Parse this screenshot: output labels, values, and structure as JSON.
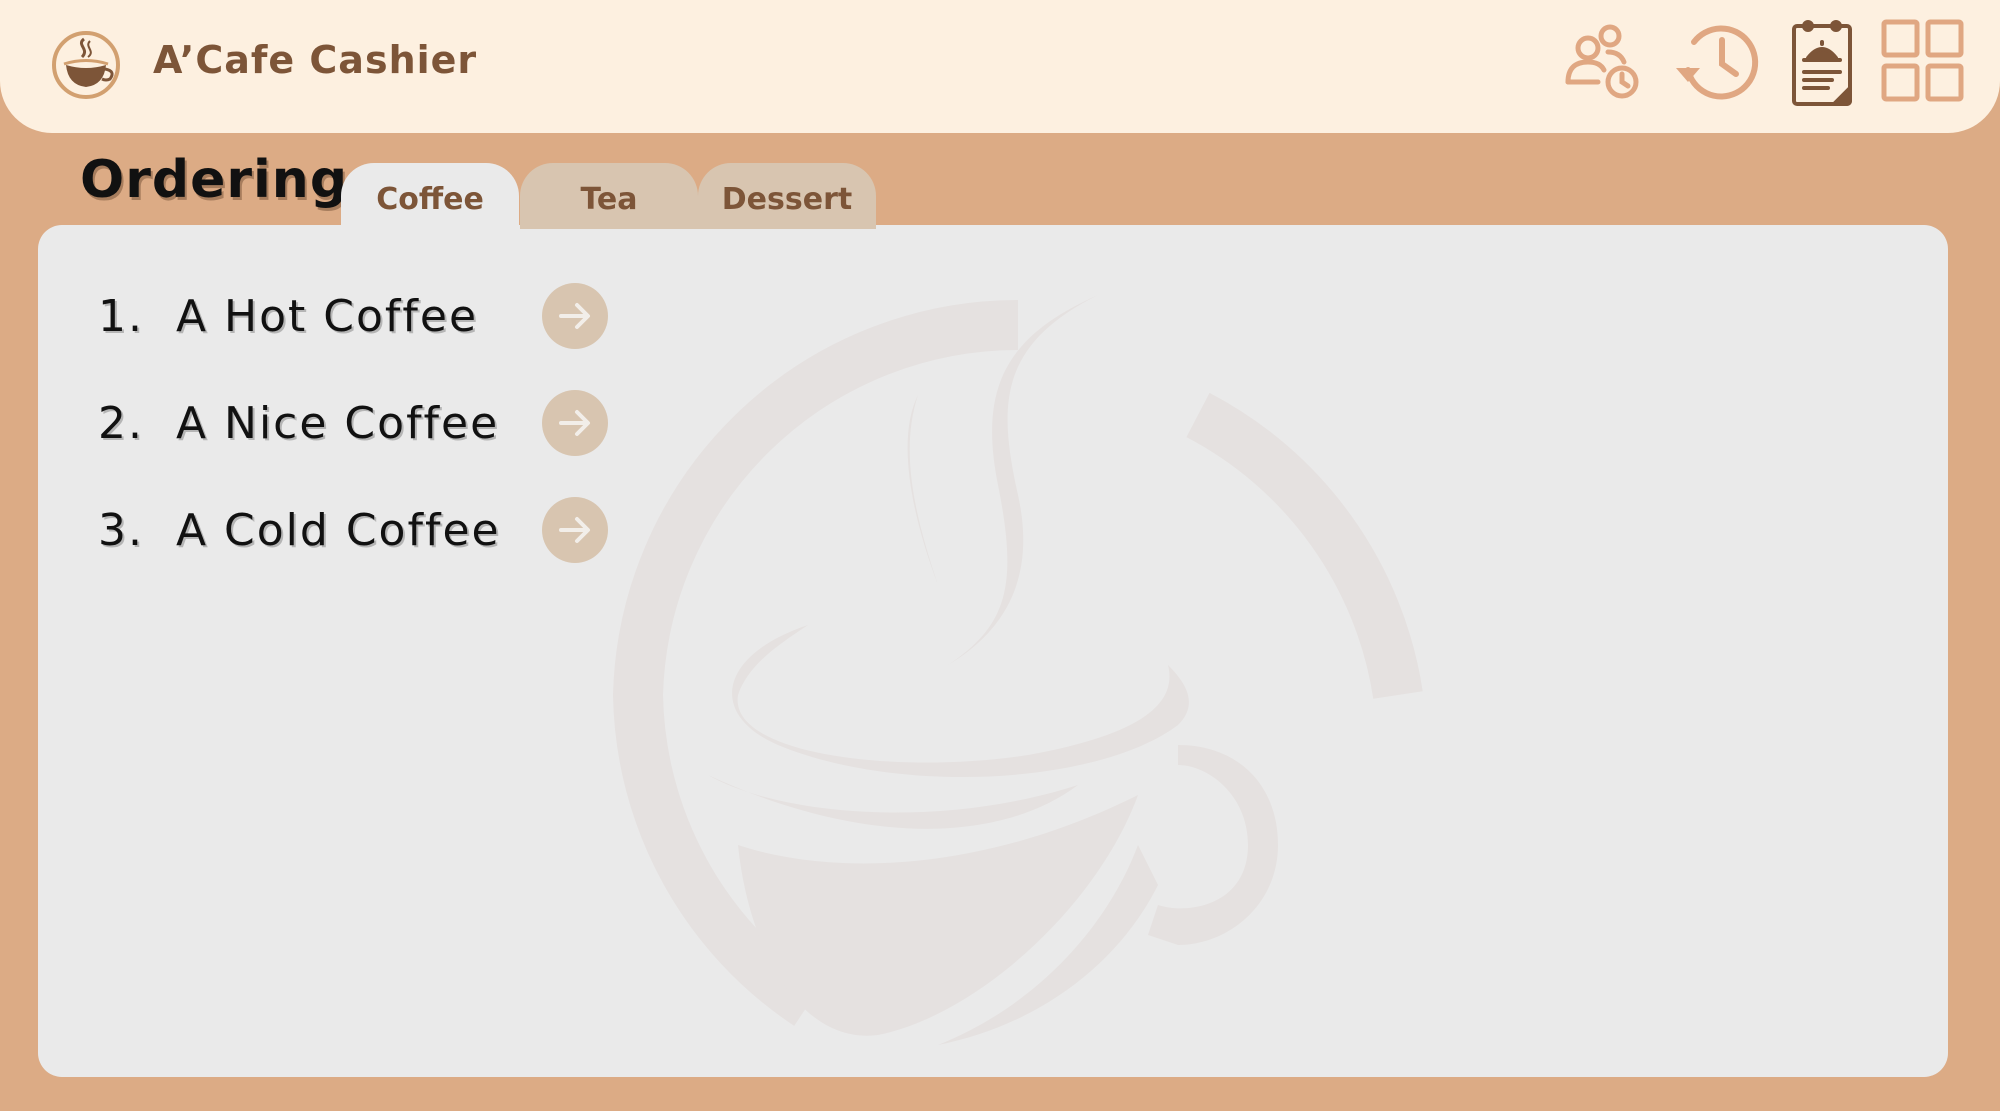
{
  "header": {
    "app_title": "A’Cafe Cashier",
    "icons": [
      "coffee-logo-icon",
      "staff-schedule-icon",
      "history-icon",
      "orders-clipboard-icon",
      "grid-menu-icon"
    ]
  },
  "page": {
    "title": "Ordering"
  },
  "tabs": [
    {
      "label": "Coffee",
      "active": true
    },
    {
      "label": "Tea",
      "active": false
    },
    {
      "label": "Dessert",
      "active": false
    }
  ],
  "menu": {
    "items": [
      {
        "label": "1.  A Hot Coffee"
      },
      {
        "label": "2.  A Nice Coffee"
      },
      {
        "label": "3.  A Cold Coffee"
      }
    ]
  },
  "colors": {
    "background": "#dcab85",
    "header_bg": "#fdf0e0",
    "panel_bg": "#eaeaea",
    "accent_brown": "#7d5538",
    "tab_inactive": "#d8c5b0",
    "icon_tan": "#e0a782"
  }
}
